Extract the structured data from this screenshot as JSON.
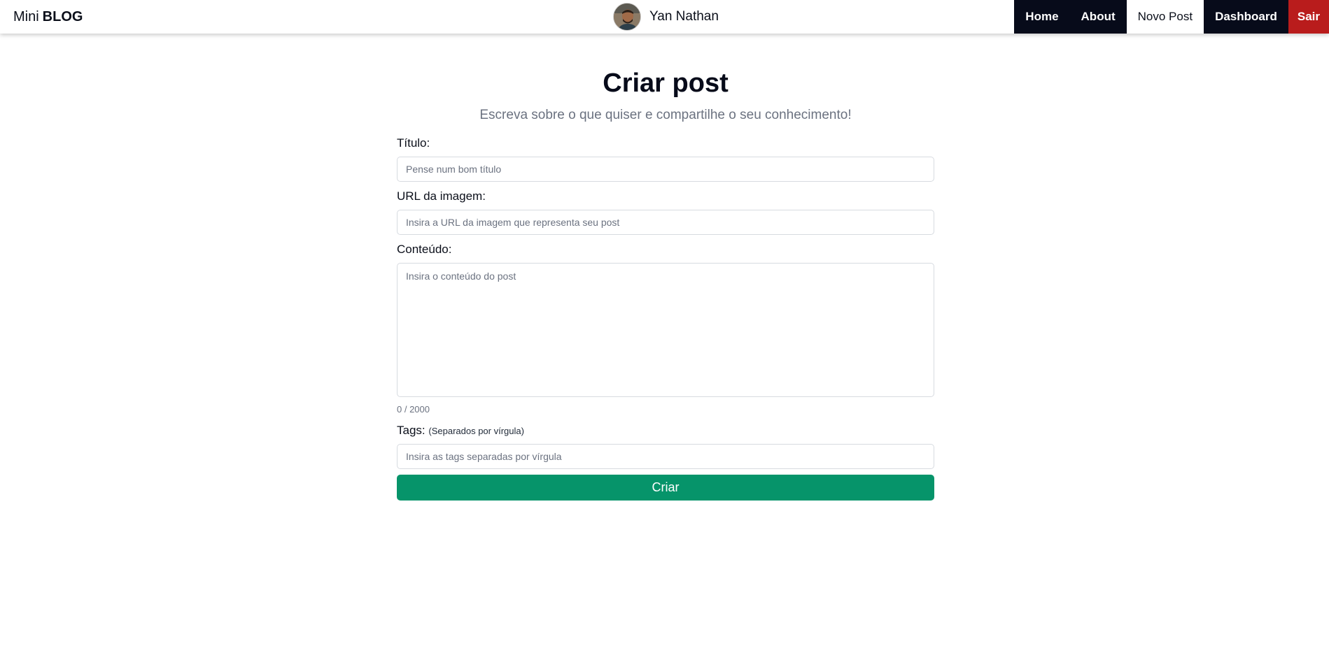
{
  "navbar": {
    "brand_prefix": "Mini",
    "brand_strong": "BLOG",
    "user_name": "Yan Nathan",
    "menu": [
      {
        "label": "Home"
      },
      {
        "label": "About"
      },
      {
        "label": "Novo Post"
      },
      {
        "label": "Dashboard"
      },
      {
        "label": "Sair"
      }
    ]
  },
  "page": {
    "title": "Criar post",
    "subtitle": "Escreva sobre o que quiser e compartilhe o seu conhecimento!"
  },
  "form": {
    "title_label": "Título:",
    "title_placeholder": "Pense num bom título",
    "image_label": "URL da imagem:",
    "image_placeholder": "Insira a URL da imagem que representa seu post",
    "content_label": "Conteúdo:",
    "content_placeholder": "Insira o conteúdo do post",
    "counter": "0 / 2000",
    "tags_label": "Tags:",
    "tags_hint": "(Separados por vírgula)",
    "tags_placeholder": "Insira as tags separadas por vírgula",
    "submit_label": "Criar"
  },
  "colors": {
    "nav_dark": "#070b1a",
    "logout_red": "#b91c1c",
    "submit_green": "#06946a"
  }
}
